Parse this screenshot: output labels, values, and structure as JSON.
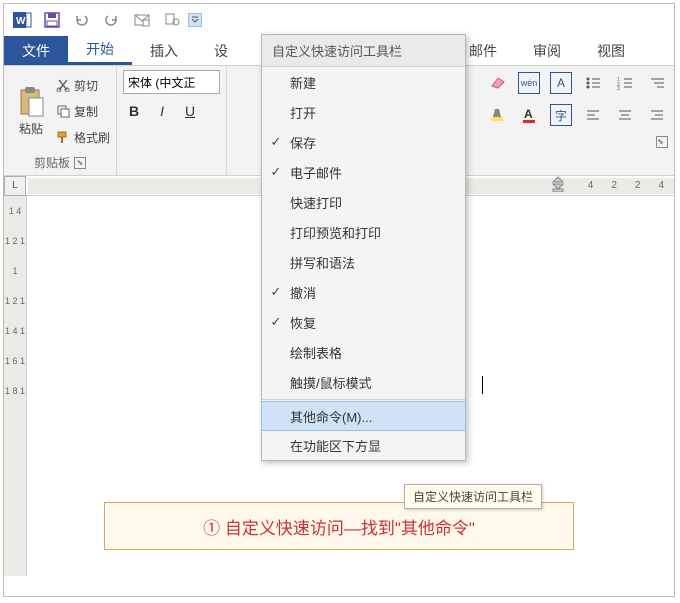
{
  "qat": {
    "caret_title": "自定义快速访问工具栏"
  },
  "tabs": {
    "file": "文件",
    "home": "开始",
    "insert": "插入",
    "design_partial": "设",
    "mail": "邮件",
    "review": "审阅",
    "view": "视图"
  },
  "clipboard": {
    "paste": "粘贴",
    "cut": "剪切",
    "copy": "复制",
    "format_painter": "格式刷",
    "group_label": "剪贴板"
  },
  "font": {
    "family_partial": "宋体 (中文正",
    "bold": "B",
    "italic": "I",
    "underline": "U"
  },
  "ribbon_right": {
    "wen": "wén",
    "A": "A",
    "char_border": "字"
  },
  "ruler": {
    "corner": "L",
    "h_marks": [
      "4",
      "2",
      "2",
      "4"
    ],
    "v_marks": [
      "1 4",
      "1 2 1",
      "1",
      "1 2 1",
      "1 4 1",
      "1 6 1",
      "1 8 1"
    ]
  },
  "dropdown": {
    "header": "自定义快速访问工具栏",
    "items": [
      {
        "label": "新建",
        "checked": false
      },
      {
        "label": "打开",
        "checked": false
      },
      {
        "label": "保存",
        "checked": true
      },
      {
        "label": "电子邮件",
        "checked": true
      },
      {
        "label": "快速打印",
        "checked": false
      },
      {
        "label": "打印预览和打印",
        "checked": false
      },
      {
        "label": "拼写和语法",
        "checked": false
      },
      {
        "label": "撤消",
        "checked": true
      },
      {
        "label": "恢复",
        "checked": true
      },
      {
        "label": "绘制表格",
        "checked": false
      },
      {
        "label": "触摸/鼠标模式",
        "checked": false
      }
    ],
    "more_commands": "其他命令(M)...",
    "below_ribbon_partial": "在功能区下方显",
    "tooltip": "自定义快速访问工具栏"
  },
  "callout": {
    "text": "① 自定义快速访问—找到\"其他命令\""
  }
}
